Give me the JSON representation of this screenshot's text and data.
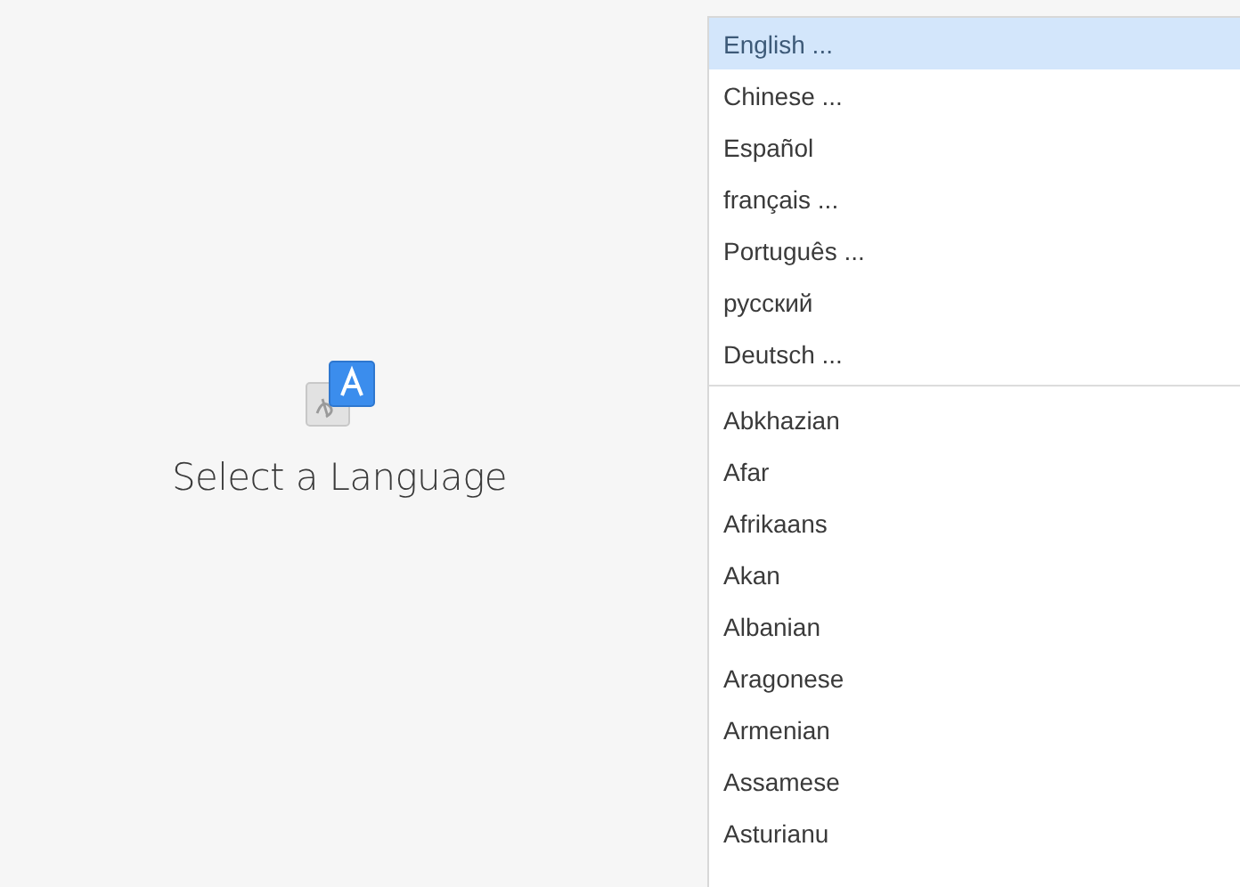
{
  "heading": "Select a Language",
  "language_groups": [
    {
      "items": [
        {
          "label": "English ...",
          "selected": true
        },
        {
          "label": "Chinese ...",
          "selected": false
        },
        {
          "label": "Español",
          "selected": false
        },
        {
          "label": "français ...",
          "selected": false
        },
        {
          "label": "Português ...",
          "selected": false
        },
        {
          "label": "русский",
          "selected": false
        },
        {
          "label": "Deutsch ...",
          "selected": false
        }
      ]
    },
    {
      "items": [
        {
          "label": "Abkhazian",
          "selected": false
        },
        {
          "label": "Afar",
          "selected": false
        },
        {
          "label": "Afrikaans",
          "selected": false
        },
        {
          "label": "Akan",
          "selected": false
        },
        {
          "label": "Albanian",
          "selected": false
        },
        {
          "label": "Aragonese",
          "selected": false
        },
        {
          "label": "Armenian",
          "selected": false
        },
        {
          "label": "Assamese",
          "selected": false
        },
        {
          "label": "Asturianu",
          "selected": false
        }
      ]
    }
  ]
}
